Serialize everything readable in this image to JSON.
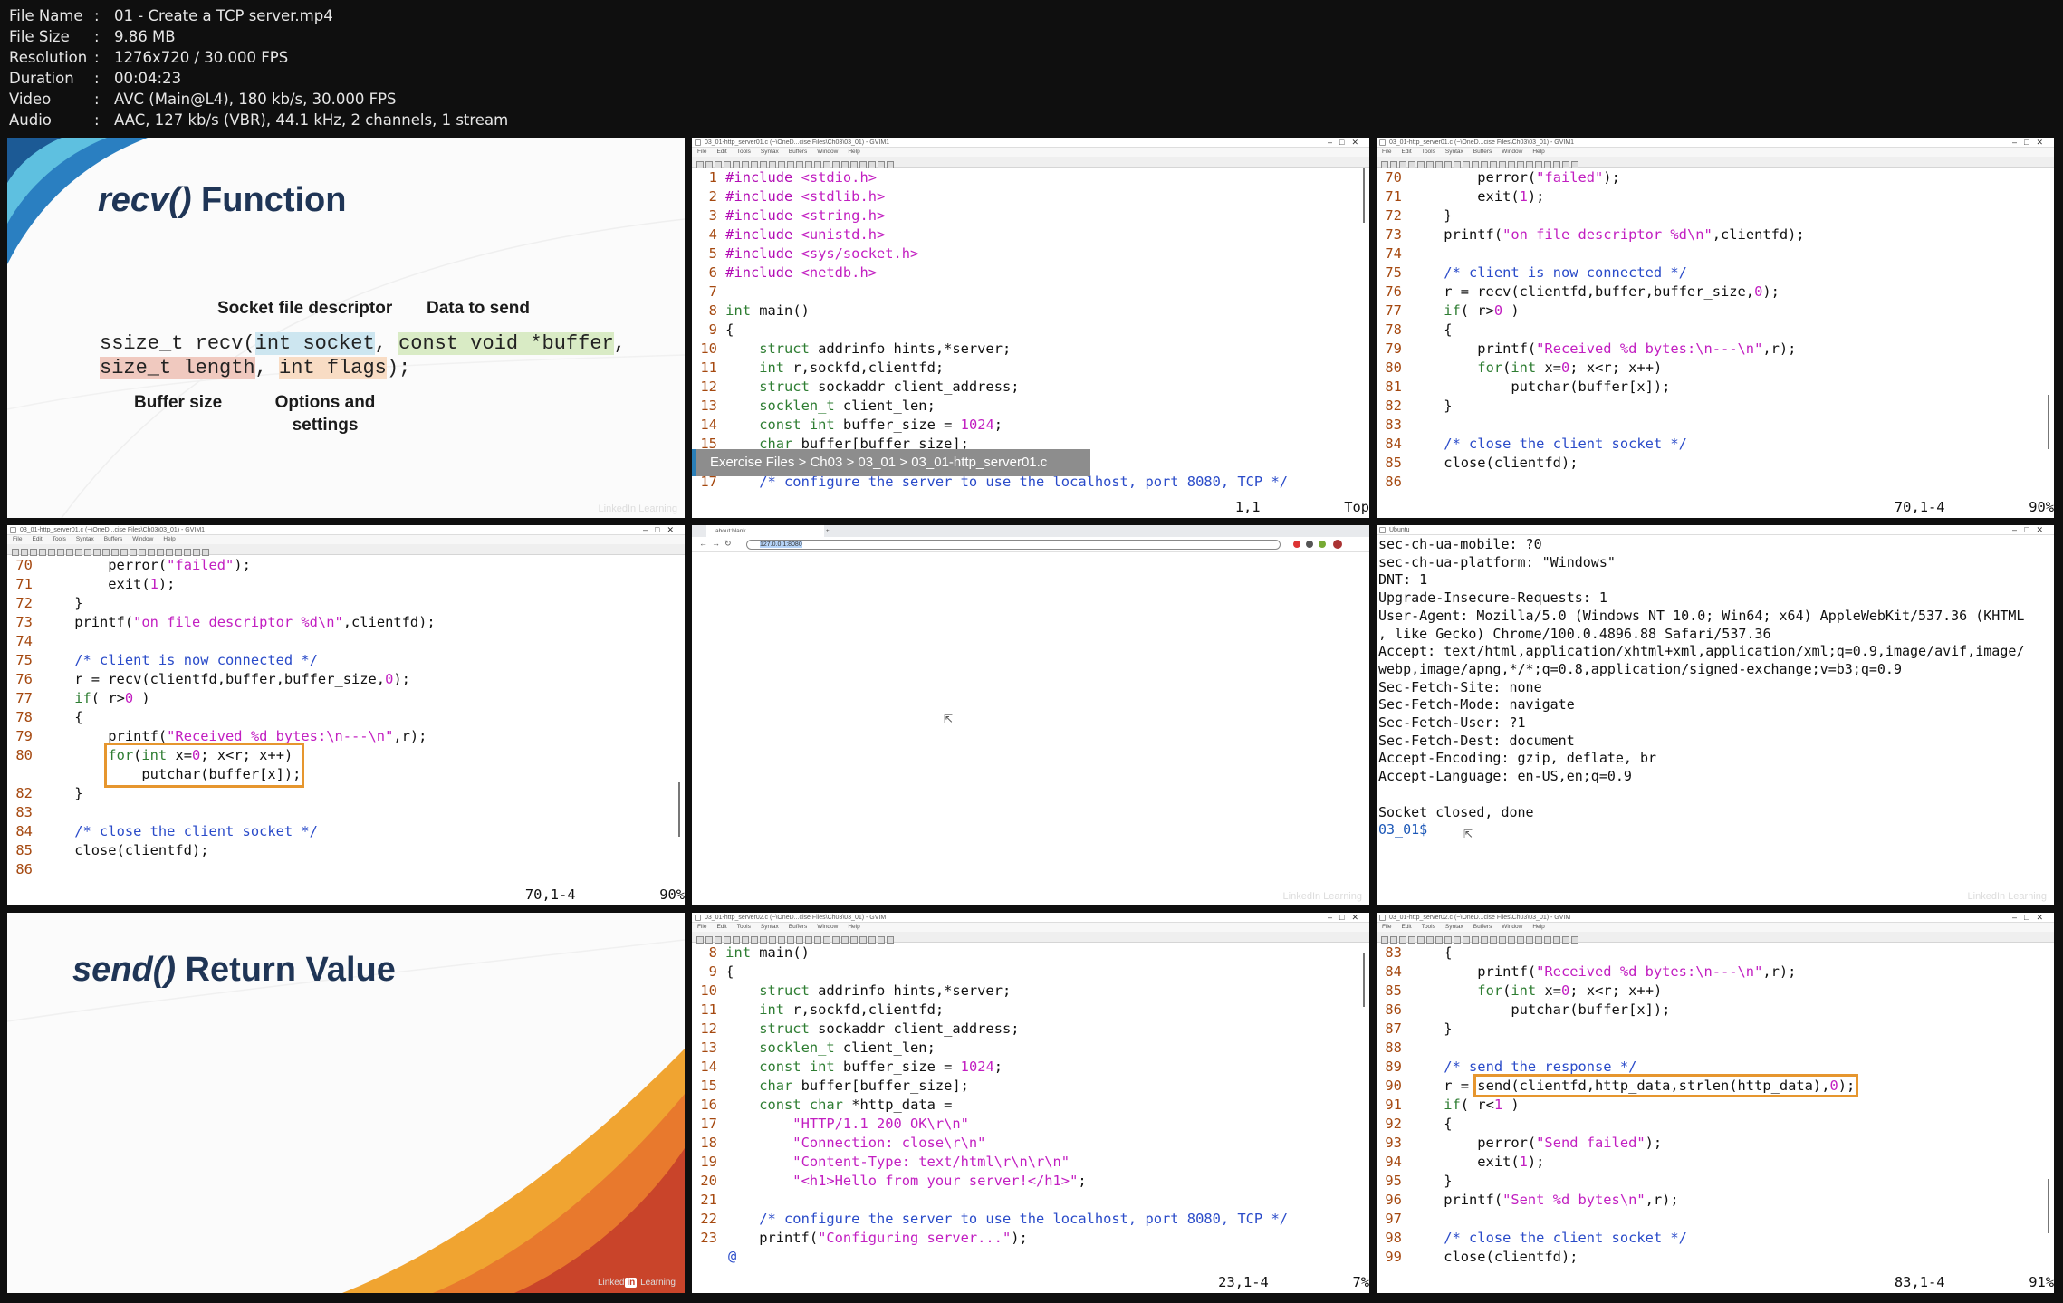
{
  "file_info": [
    {
      "key": "File Name",
      "value": "01 - Create a TCP server.mp4"
    },
    {
      "key": "File Size",
      "value": "9.86 MB"
    },
    {
      "key": "Resolution",
      "value": "1276x720 / 30.000 FPS"
    },
    {
      "key": "Duration",
      "value": "00:04:23"
    },
    {
      "key": "Video",
      "value": "AVC (Main@L4), 180 kb/s, 30.000 FPS"
    },
    {
      "key": "Audio",
      "value": "AAC, 127 kb/s (VBR), 44.1 kHz, 2 channels, 1 stream"
    }
  ],
  "separator": ":",
  "slide1": {
    "title_italic": "recv()",
    "title_rest": " Function",
    "labels": {
      "socket_fd": "Socket file descriptor",
      "data": "Data to send",
      "buffer_size": "Buffer size",
      "options": "Options and settings"
    },
    "signature": {
      "prefix": "ssize_t recv(",
      "arg1": "int socket",
      "comma1": ", ",
      "arg2": "const void *buffer",
      "comma2": ",",
      "arg3": "size_t length",
      "comma3": ", ",
      "arg4": "int flags",
      "suffix": ");"
    },
    "watermark": "LinkedIn Learning"
  },
  "editor_menu": [
    "File",
    "Edit",
    "Tools",
    "Syntax",
    "Buffers",
    "Window",
    "Help"
  ],
  "editor2": {
    "title": "03_01-http_server01.c (~\\OneD...cise Files\\Ch03\\03_01) - GVIM1",
    "breadcrumb": "Exercise Files > Ch03 > 03_01 > 03_01-http_server01.c",
    "status_pos": "1,1",
    "status_pct": "Top",
    "lines": [
      [
        "1",
        "#include <stdio.h>"
      ],
      [
        "2",
        "#include <stdlib.h>"
      ],
      [
        "3",
        "#include <string.h>"
      ],
      [
        "4",
        "#include <unistd.h>"
      ],
      [
        "5",
        "#include <sys/socket.h>"
      ],
      [
        "6",
        "#include <netdb.h>"
      ],
      [
        "7",
        ""
      ],
      [
        "8",
        "int main()"
      ],
      [
        "9",
        "{"
      ],
      [
        "10",
        "    struct addrinfo hints,*server;"
      ],
      [
        "11",
        "    int r,sockfd,clientfd;"
      ],
      [
        "12",
        "    struct sockaddr client_address;"
      ],
      [
        "13",
        "    socklen_t client_len;"
      ],
      [
        "14",
        "    const int buffer_size = 1024;"
      ],
      [
        "15",
        "    char buffer[buffer_size];"
      ],
      [
        "16",
        ""
      ],
      [
        "17",
        "    /* configure the server to use the localhost, port 8080, TCP */"
      ]
    ]
  },
  "editor3": {
    "title": "03_01-http_server01.c (~\\OneD...cise Files\\Ch03\\03_01) - GVIM1",
    "status_pos": "70,1-4",
    "status_pct": "90%",
    "lines": [
      [
        "70",
        "        perror(\"failed\");"
      ],
      [
        "71",
        "        exit(1);"
      ],
      [
        "72",
        "    }"
      ],
      [
        "73",
        "    printf(\"on file descriptor %d\\n\",clientfd);"
      ],
      [
        "74",
        ""
      ],
      [
        "75",
        "    /* client is now connected */"
      ],
      [
        "76",
        "    r = recv(clientfd,buffer,buffer_size,0);"
      ],
      [
        "77",
        "    if( r>0 )"
      ],
      [
        "78",
        "    {"
      ],
      [
        "79",
        "        printf(\"Received %d bytes:\\n---\\n\",r);"
      ],
      [
        "80",
        "        for(int x=0; x<r; x++)"
      ],
      [
        "81",
        "            putchar(buffer[x]);"
      ],
      [
        "82",
        "    }"
      ],
      [
        "83",
        ""
      ],
      [
        "84",
        "    /* close the client socket */"
      ],
      [
        "85",
        "    close(clientfd);"
      ],
      [
        "86",
        ""
      ]
    ]
  },
  "editor4": {
    "title": "03_01-http_server01.c (~\\OneD...cise Files\\Ch03\\03_01) - GVIM1",
    "status_pos": "70,1-4",
    "status_pct": "90%"
  },
  "browser": {
    "tab_title": "about:blank",
    "url": "127.0.0.1:8080"
  },
  "terminal": {
    "title": "Ubuntu",
    "lines": [
      "sec-ch-ua-mobile: ?0",
      "sec-ch-ua-platform: \"Windows\"",
      "DNT: 1",
      "Upgrade-Insecure-Requests: 1",
      "User-Agent: Mozilla/5.0 (Windows NT 10.0; Win64; x64) AppleWebKit/537.36 (KHTML",
      ", like Gecko) Chrome/100.0.4896.88 Safari/537.36",
      "Accept: text/html,application/xhtml+xml,application/xml;q=0.9,image/avif,image/",
      "webp,image/apng,*/*;q=0.8,application/signed-exchange;v=b3;q=0.9",
      "Sec-Fetch-Site: none",
      "Sec-Fetch-Mode: navigate",
      "Sec-Fetch-User: ?1",
      "Sec-Fetch-Dest: document",
      "Accept-Encoding: gzip, deflate, br",
      "Accept-Language: en-US,en;q=0.9",
      "",
      "Socket closed, done"
    ],
    "prompt": "03_01$"
  },
  "slide2": {
    "title_italic": "send()",
    "title_rest": " Return Value",
    "logo": "Linked in Learning"
  },
  "editor8": {
    "title": "03_01-http_server02.c (~\\OneD...cise Files\\Ch03\\03_01) - GVIM",
    "status_pos": "23,1-4",
    "status_pct": "7%",
    "lines": [
      [
        "8",
        "int main()"
      ],
      [
        "9",
        "{"
      ],
      [
        "10",
        "    struct addrinfo hints,*server;"
      ],
      [
        "11",
        "    int r,sockfd,clientfd;"
      ],
      [
        "12",
        "    struct sockaddr client_address;"
      ],
      [
        "13",
        "    socklen_t client_len;"
      ],
      [
        "14",
        "    const int buffer_size = 1024;"
      ],
      [
        "15",
        "    char buffer[buffer_size];"
      ],
      [
        "16",
        "    const char *http_data ="
      ],
      [
        "17",
        "        \"HTTP/1.1 200 OK\\r\\n\""
      ],
      [
        "18",
        "        \"Connection: close\\r\\n\""
      ],
      [
        "19",
        "        \"Content-Type: text/html\\r\\n\\r\\n\""
      ],
      [
        "20",
        "        \"<h1>Hello from your server!</h1>\";"
      ],
      [
        "21",
        ""
      ],
      [
        "22",
        "    /* configure the server to use the localhost, port 8080, TCP */"
      ],
      [
        "23",
        "    printf(\"Configuring server...\");"
      ]
    ],
    "tail": "@"
  },
  "editor9": {
    "title": "03_01-http_server02.c (~\\OneD...cise Files\\Ch03\\03_01) - GVIM",
    "status_pos": "83,1-4",
    "status_pct": "91%",
    "lines": [
      [
        "83",
        "    {"
      ],
      [
        "84",
        "        printf(\"Received %d bytes:\\n---\\n\",r);"
      ],
      [
        "85",
        "        for(int x=0; x<r; x++)"
      ],
      [
        "86",
        "            putchar(buffer[x]);"
      ],
      [
        "87",
        "    }"
      ],
      [
        "88",
        ""
      ],
      [
        "89",
        "    /* send the response */"
      ],
      [
        "90",
        "    r = send(clientfd,http_data,strlen(http_data),0);"
      ],
      [
        "91",
        "    if( r<1 )"
      ],
      [
        "92",
        "    {"
      ],
      [
        "93",
        "        perror(\"Send failed\");"
      ],
      [
        "94",
        "        exit(1);"
      ],
      [
        "95",
        "    }"
      ],
      [
        "96",
        "    printf(\"Sent %d bytes\\n\",r);"
      ],
      [
        "97",
        ""
      ],
      [
        "98",
        "    /* close the client socket */"
      ],
      [
        "99",
        "    close(clientfd);"
      ]
    ]
  }
}
